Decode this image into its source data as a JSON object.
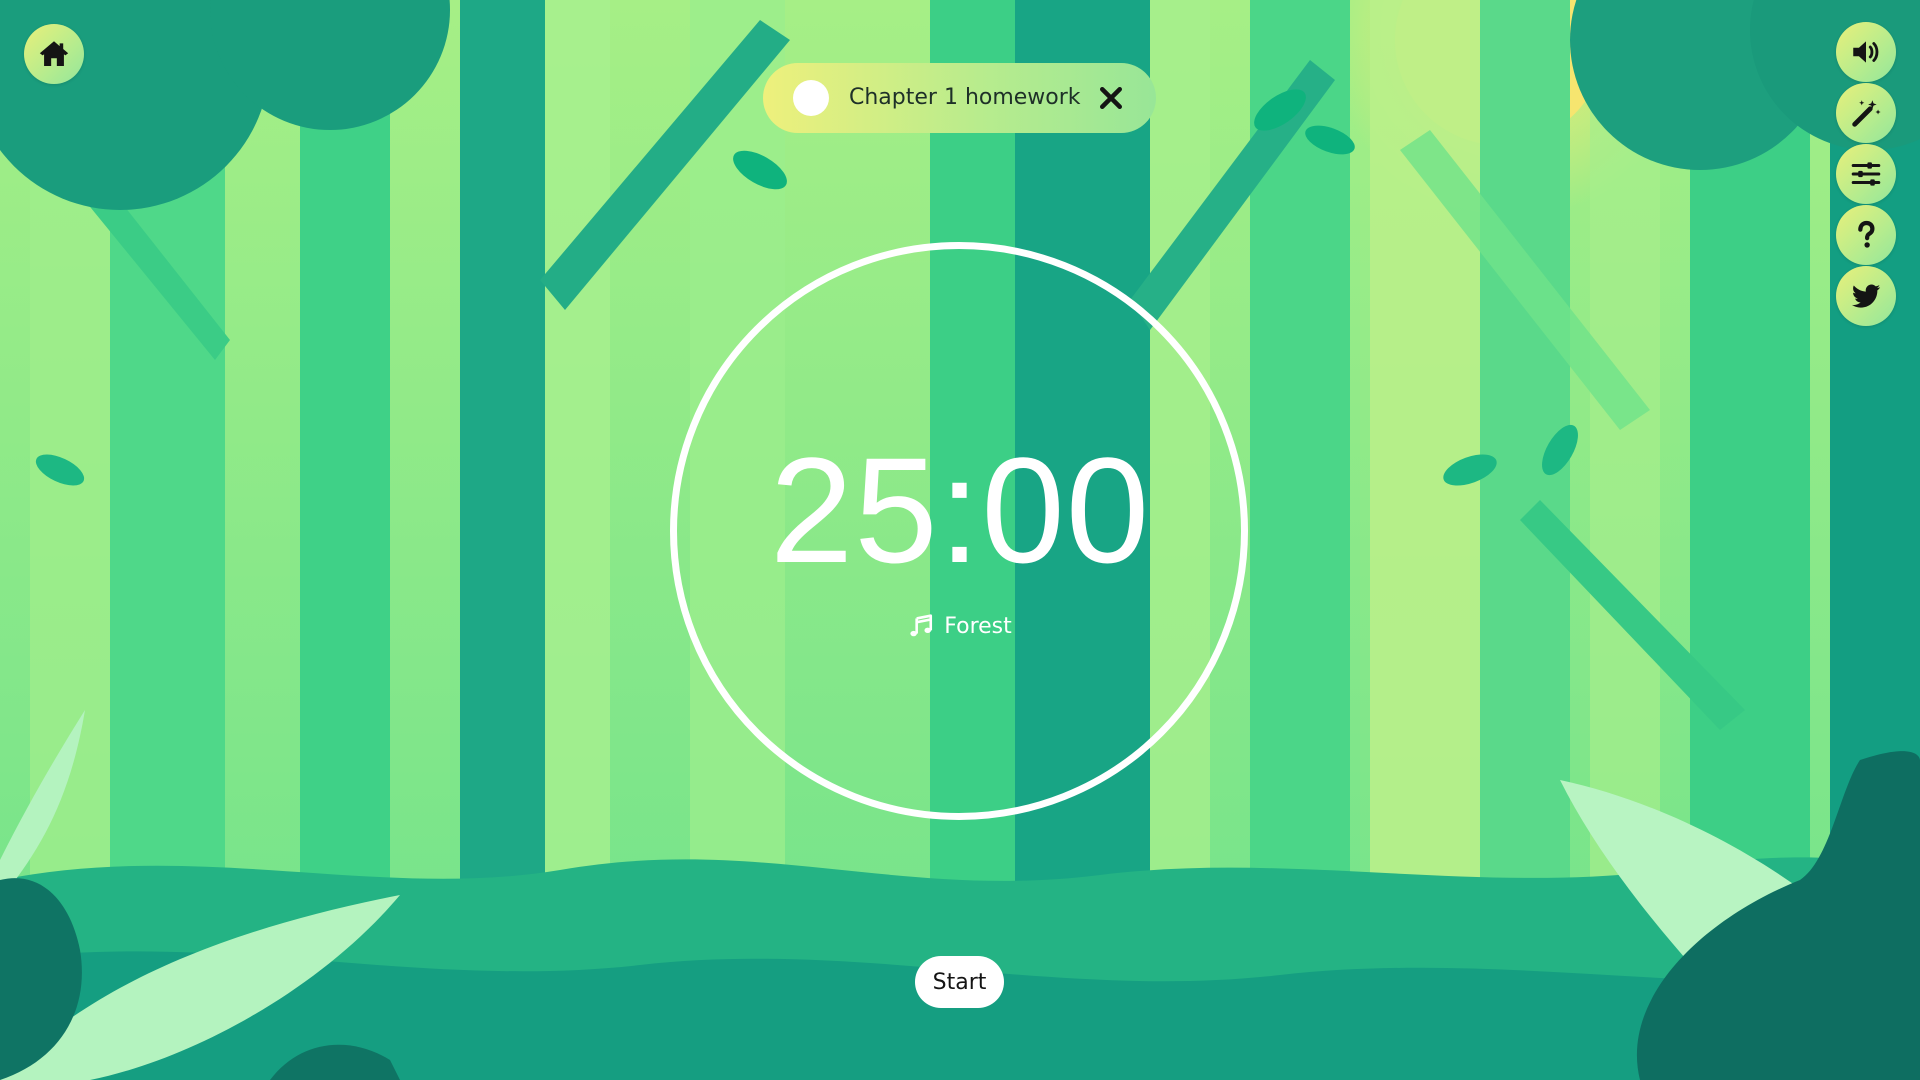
{
  "task": {
    "label": "Chapter 1 homework"
  },
  "timer": {
    "value": "25:00",
    "sound_label": "Forest"
  },
  "controls": {
    "start_label": "Start"
  },
  "icons": {
    "home": "home-icon",
    "sound": "volume-icon",
    "theme": "magic-wand-icon",
    "settings": "sliders-icon",
    "help": "question-icon",
    "social": "twitter-icon",
    "close": "close-icon",
    "music": "music-note-icon"
  },
  "colors": {
    "button_gradient_start": "#e9f07a",
    "button_gradient_end": "#93e69c",
    "icon": "#141414",
    "ring": "#ffffff",
    "forest_light": "#8ee98a",
    "forest_mid": "#4fd98a",
    "forest_dark": "#12a383",
    "sun": "#f5e978"
  }
}
